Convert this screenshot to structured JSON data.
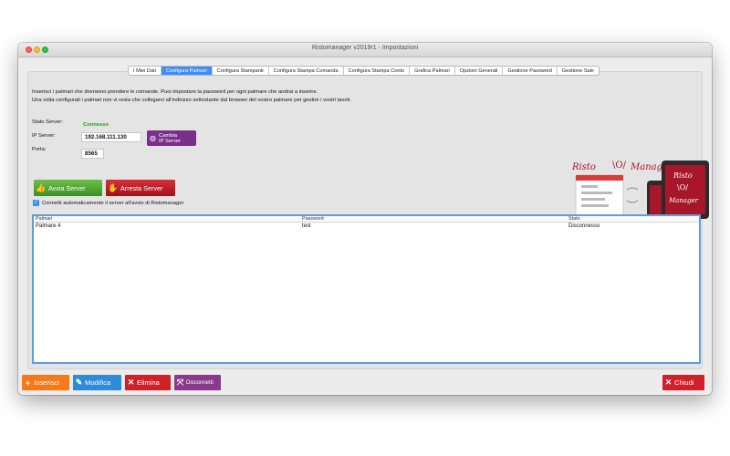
{
  "window": {
    "title": "Ristomanager v2019r1 - Impostazioni"
  },
  "tabs": [
    {
      "label": "I Miei Dati",
      "active": false
    },
    {
      "label": "Configura Palmari",
      "active": true
    },
    {
      "label": "Configura Stampanti",
      "active": false
    },
    {
      "label": "Configura Stampa Comanda",
      "active": false
    },
    {
      "label": "Configura Stampa Conto",
      "active": false
    },
    {
      "label": "Grafica Palmari",
      "active": false
    },
    {
      "label": "Opzioni Generali",
      "active": false
    },
    {
      "label": "Gestione Password",
      "active": false
    },
    {
      "label": "Gestione Sale",
      "active": false
    }
  ],
  "instructions": {
    "line1": "Inserisci i palmari che dovranno prendere le comande. Puoi impostare la password per ogni palmare che andrai a inserire.",
    "line2": "Una volta configurati i palmari non vi resta che collegarvi all'indirizzo sottostante dal browser del vostro palmare per gestire i vostri tavoli."
  },
  "server": {
    "status_label": "Stato Server:",
    "status_value": "Connesso",
    "ip_label": "IP Server:",
    "ip_value": "192.168.111.130",
    "port_label": "Porta:",
    "port_value": "8565",
    "change_ip_line1": "Cambia",
    "change_ip_line2": "IP Server",
    "start_label": "Avvia Server",
    "stop_label": "Arresta Server",
    "auto_connect_label": "Connetti automaticamente il server all'avvio di Ristomanager",
    "auto_connect_checked": true
  },
  "logo": {
    "text1": "Risto",
    "text2": "Manager"
  },
  "table": {
    "columns": [
      "Palmari",
      "Password",
      "Stato"
    ],
    "rows": [
      [
        "Palmare 4",
        "test",
        "Disconnesso"
      ]
    ]
  },
  "footer": {
    "insert_label": "Inserisci",
    "edit_label": "Modifica",
    "delete_label": "Elimina",
    "disconnect_label": "Disconnetti",
    "close_label": "Chiudi"
  },
  "colors": {
    "accent": "#3d8ef5",
    "status_ok": "#1f9e1f",
    "start": "#4e9e30",
    "stop": "#c01822",
    "insert": "#f47a19",
    "edit": "#2d8bd8",
    "delete": "#d0202a",
    "disconnect": "#8a3a8a"
  }
}
